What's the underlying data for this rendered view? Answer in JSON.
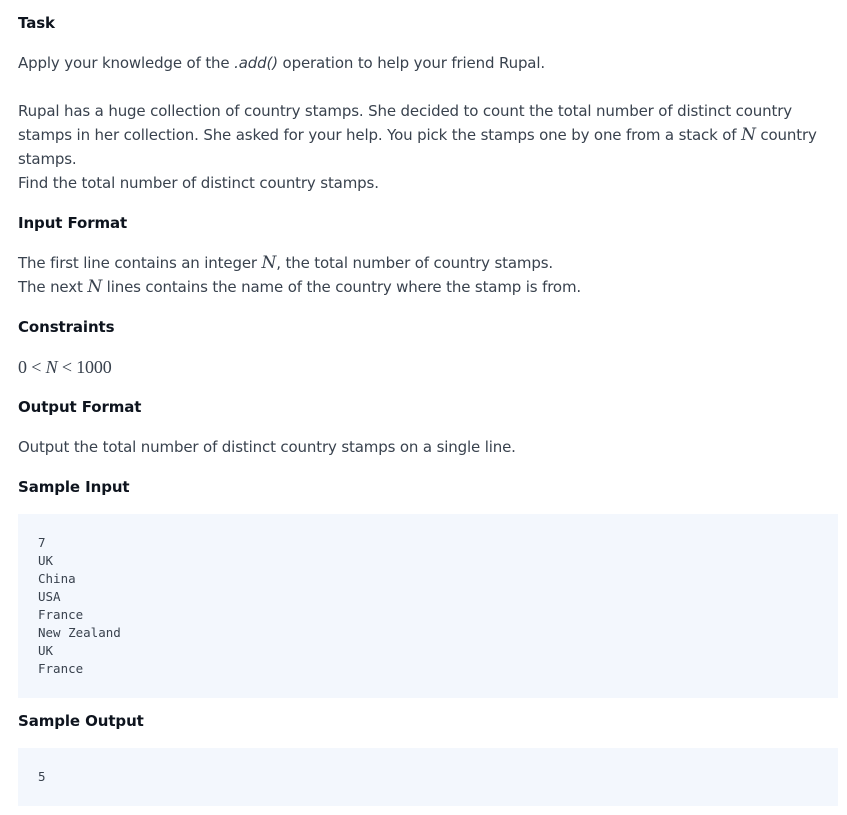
{
  "task": {
    "heading": "Task",
    "intro_pre": "Apply your knowledge of the ",
    "intro_code": ".add()",
    "intro_post": " operation to help your friend Rupal.",
    "story_pre": "Rupal has a huge collection of country stamps. She decided to count the total number of distinct country stamps in her collection. She asked for your help. You pick the stamps one by one from a stack of ",
    "story_var": "N",
    "story_post": " country stamps.",
    "goal": "Find the total number of distinct country stamps."
  },
  "input_format": {
    "heading": "Input Format",
    "line1_pre": "The first line contains an integer ",
    "line1_var": "N",
    "line1_post": ", the total number of country stamps.",
    "line2_pre": "The next ",
    "line2_var": "N",
    "line2_post": " lines contains the name of the country where the stamp is from."
  },
  "constraints": {
    "heading": "Constraints",
    "low": "0",
    "op1": "<",
    "var": "N",
    "op2": "<",
    "high": "1000"
  },
  "output_format": {
    "heading": "Output Format",
    "text": "Output the total number of distinct country stamps on a single line."
  },
  "sample_input": {
    "heading": "Sample Input",
    "lines": [
      "7",
      "UK",
      "China",
      "USA",
      "France",
      "New Zealand",
      "UK",
      "France"
    ]
  },
  "sample_output": {
    "heading": "Sample Output",
    "lines": [
      "5"
    ]
  }
}
